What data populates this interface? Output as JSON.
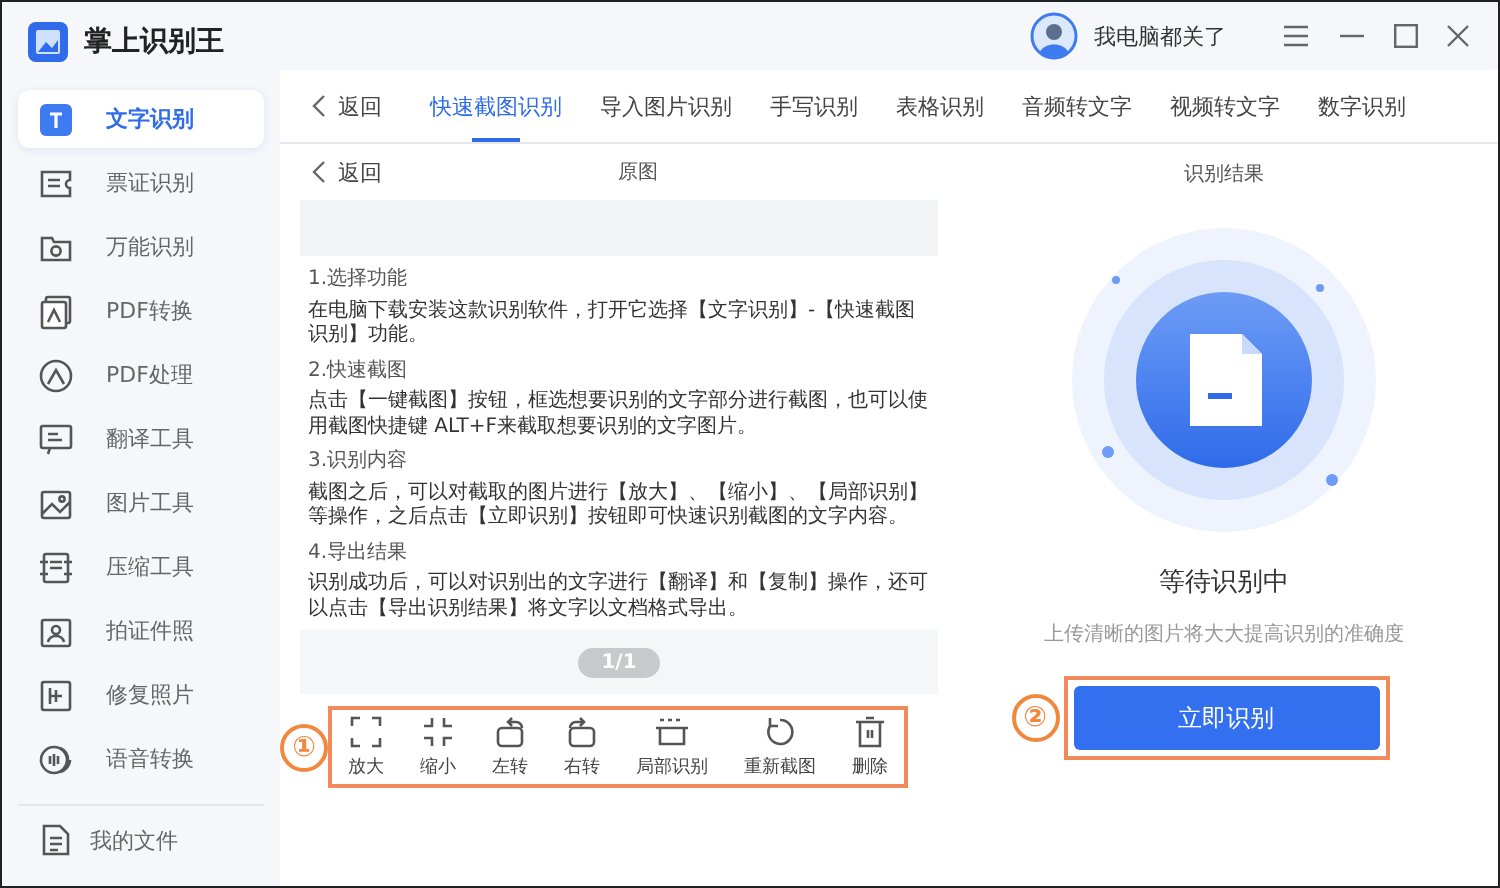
{
  "app": {
    "title": "掌上识别王"
  },
  "user": {
    "name": "我电脑都关了"
  },
  "sidebar": {
    "items": [
      {
        "label": "文字识别",
        "selected": true
      },
      {
        "label": "票证识别",
        "selected": false
      },
      {
        "label": "万能识别",
        "selected": false
      },
      {
        "label": "PDF转换",
        "selected": false
      },
      {
        "label": "PDF处理",
        "selected": false
      },
      {
        "label": "翻译工具",
        "selected": false
      },
      {
        "label": "图片工具",
        "selected": false
      },
      {
        "label": "压缩工具",
        "selected": false
      },
      {
        "label": "拍证件照",
        "selected": false
      },
      {
        "label": "修复照片",
        "selected": false
      },
      {
        "label": "语音转换",
        "selected": false
      }
    ],
    "footer": {
      "label": "我的文件"
    }
  },
  "tab_bar": {
    "back": "返回",
    "tabs": [
      {
        "label": "快速截图识别",
        "selected": true
      },
      {
        "label": "导入图片识别",
        "selected": false
      },
      {
        "label": "手写识别",
        "selected": false
      },
      {
        "label": "表格识别",
        "selected": false
      },
      {
        "label": "音频转文字",
        "selected": false
      },
      {
        "label": "视频转文字",
        "selected": false
      },
      {
        "label": "数字识别",
        "selected": false
      }
    ]
  },
  "original_pane": {
    "back": "返回",
    "title": "原图",
    "document": [
      {
        "kind": "heading",
        "text": "1.选择功能"
      },
      {
        "kind": "para",
        "text": "在电脑下载安装这款识别软件，打开它选择【文字识别】-【快速截图识别】功能。"
      },
      {
        "kind": "heading",
        "text": "2.快速截图"
      },
      {
        "kind": "para",
        "text": "点击【一键截图】按钮，框选想要识别的文字部分进行截图，也可以使用截图快捷键 ALT+F来截取想要识别的文字图片。"
      },
      {
        "kind": "heading",
        "text": "3.识别内容"
      },
      {
        "kind": "para",
        "text": "截图之后，可以对截取的图片进行【放大】、【缩小】、【局部识别】等操作，之后点击【立即识别】按钮即可快速识别截图的文字内容。"
      },
      {
        "kind": "heading",
        "text": "4.导出结果"
      },
      {
        "kind": "para",
        "text": "识别成功后，可以对识别出的文字进行【翻译】和【复制】操作，还可以点击【导出识别结果】将文字以文档格式导出。"
      }
    ],
    "pager": "1/1",
    "toolbar": {
      "marker": "①",
      "tools": [
        {
          "kind": "zoom-in",
          "label": "放大"
        },
        {
          "kind": "zoom-out",
          "label": "缩小"
        },
        {
          "kind": "rotate-left",
          "label": "左转"
        },
        {
          "kind": "rotate-right",
          "label": "右转"
        },
        {
          "kind": "crop",
          "label": "局部识别"
        },
        {
          "kind": "redo",
          "label": "重新截图"
        },
        {
          "kind": "delete",
          "label": "删除"
        }
      ]
    }
  },
  "result_pane": {
    "title": "识别结果",
    "status": "等待识别中",
    "hint": "上传清晰的图片将大大提高识别的准确度",
    "button": {
      "label": "立即识别",
      "marker": "②"
    }
  }
}
